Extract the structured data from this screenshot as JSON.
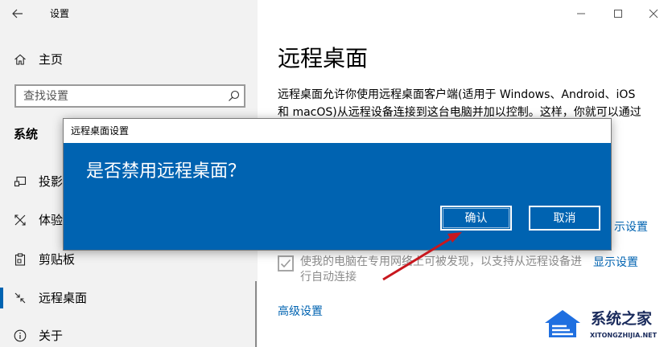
{
  "window": {
    "title": "设置"
  },
  "sidebar": {
    "home_label": "主页",
    "search_placeholder": "查找设置",
    "section_title": "系统",
    "items": [
      {
        "label": "投影",
        "icon": "projector-icon"
      },
      {
        "label": "体验",
        "icon": "share-icon"
      },
      {
        "label": "剪贴板",
        "icon": "clipboard-icon"
      },
      {
        "label": "远程桌面",
        "icon": "remote-desktop-icon",
        "selected": true
      },
      {
        "label": "关于",
        "icon": "info-icon"
      }
    ]
  },
  "main": {
    "title": "远程桌面",
    "description_lines": [
      "远程桌面允许你使用远程桌面客户端(适用于 Windows、Android、iOS",
      "和 macOS)从远程设备连接到这台电脑并加以控制。这样，你就可以通过"
    ],
    "partial_link": "示设置",
    "discoverable": {
      "checked": true,
      "text_lines": [
        "使我的电脑在专用网络上可被发现，以支持从远程设备进",
        "行自动连接"
      ],
      "link": "显示设置"
    },
    "advanced_link": "高级设置"
  },
  "dialog": {
    "title": "远程桌面设置",
    "question": "是否禁用远程桌面？",
    "confirm": "确认",
    "cancel": "取消"
  },
  "watermark": {
    "name": "系统之家",
    "url": "XITONGZHIJIA.NET"
  },
  "colors": {
    "accent": "#0063b1",
    "dialog": "#0063b1",
    "arrow": "#c8171e",
    "sidebar_bg": "#f2f2f2",
    "disabled_text": "#8c8c8c"
  }
}
